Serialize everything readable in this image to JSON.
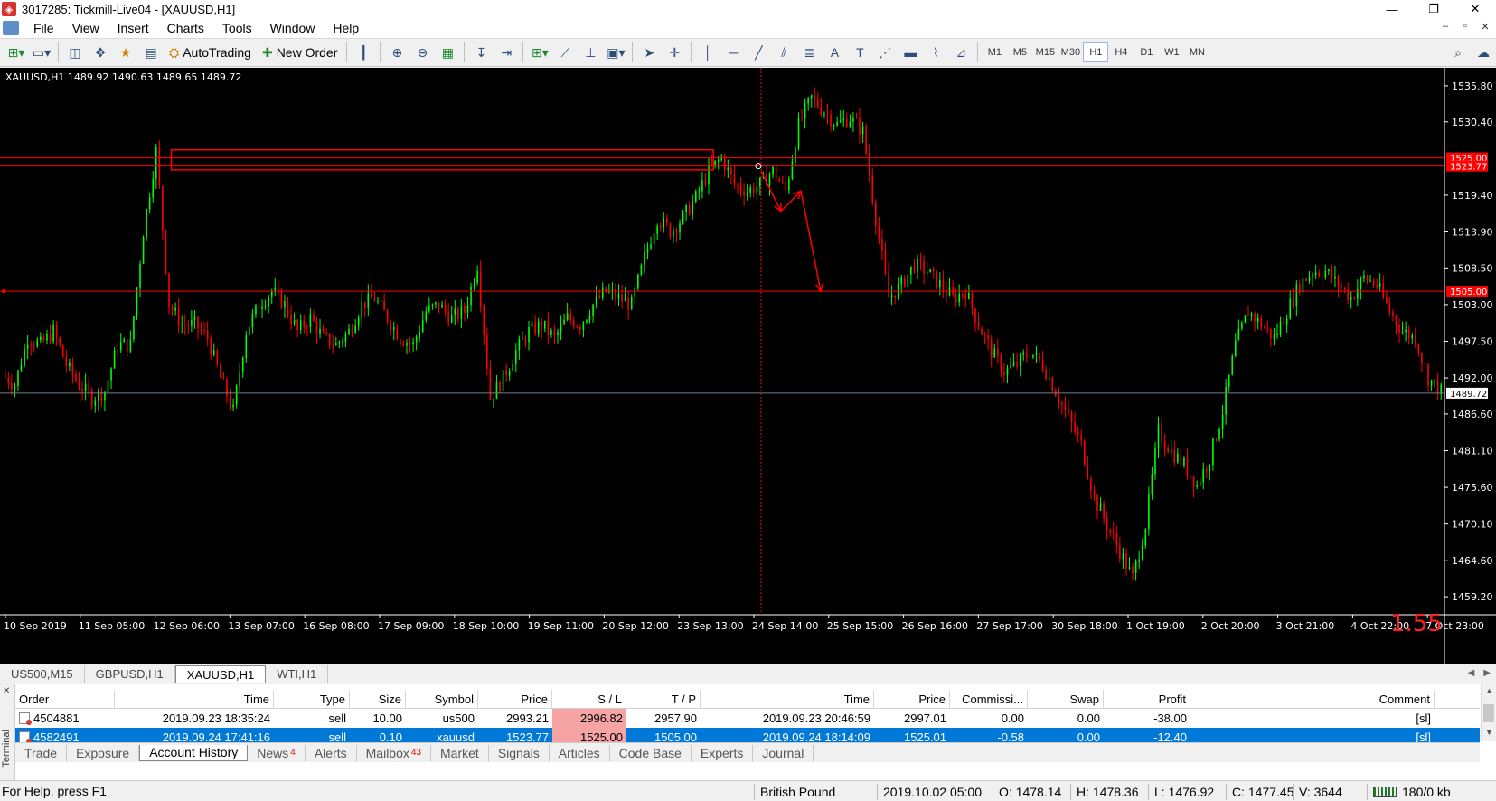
{
  "window": {
    "title": "3017285: Tickmill-Live04 - [XAUUSD,H1]",
    "controls": [
      "—",
      "❐",
      "✕"
    ],
    "mdi_controls": [
      "–",
      "▫",
      "✕"
    ]
  },
  "menu": [
    "File",
    "View",
    "Insert",
    "Charts",
    "Tools",
    "Window",
    "Help"
  ],
  "toolbar": {
    "autotrading_label": "AutoTrading",
    "new_order_label": "New Order",
    "timeframes": [
      "M1",
      "M5",
      "M15",
      "M30",
      "H1",
      "H4",
      "D1",
      "W1",
      "MN"
    ],
    "active_timeframe": "H1"
  },
  "chart": {
    "header": "XAUUSD,H1  1489.92 1490.63 1489.65 1489.72",
    "spread": "1.55",
    "price_labels": [
      "1535.80",
      "1530.40",
      "1519.40",
      "1513.90",
      "1508.50",
      "1503.00",
      "1497.50",
      "1492.00",
      "1486.60",
      "1481.10",
      "1475.60",
      "1470.10",
      "1464.60",
      "1459.20"
    ],
    "marker_labels": [
      "1525.00",
      "1523.77",
      "1505.00",
      "1489.72"
    ],
    "time_labels": [
      "10 Sep 2019",
      "11 Sep 05:00",
      "12 Sep 06:00",
      "13 Sep 07:00",
      "16 Sep 08:00",
      "17 Sep 09:00",
      "18 Sep 10:00",
      "19 Sep 11:00",
      "20 Sep 12:00",
      "23 Sep 13:00",
      "24 Sep 14:00",
      "25 Sep 15:00",
      "26 Sep 16:00",
      "27 Sep 17:00",
      "30 Sep 18:00",
      "1 Oct 19:00",
      "2 Oct 20:00",
      "3 Oct 21:00",
      "4 Oct 22:00",
      "7 Oct 23:00"
    ],
    "colors": {
      "bull": "#00ff00",
      "bear": "#ff0000",
      "background": "#000000",
      "line_red": "#ff0000",
      "bid_line": "#708090"
    }
  },
  "chart_data": {
    "type": "candlestick",
    "symbol": "XAUUSD",
    "timeframe": "H1",
    "ylim": [
      1456.5,
      1538.5
    ],
    "x": [
      "10 Sep 2019",
      "11 Sep 05:00",
      "12 Sep 06:00",
      "13 Sep 07:00",
      "16 Sep 08:00",
      "17 Sep 09:00",
      "18 Sep 10:00",
      "19 Sep 11:00",
      "20 Sep 12:00",
      "23 Sep 13:00",
      "24 Sep 14:00",
      "25 Sep 15:00",
      "26 Sep 16:00",
      "27 Sep 17:00",
      "30 Sep 18:00",
      "1 Oct 19:00",
      "2 Oct 20:00",
      "3 Oct 21:00",
      "4 Oct 22:00",
      "7 Oct 23:00"
    ],
    "close_path": [
      1492.5,
      1491.0,
      1498.0,
      1497.0,
      1499.0,
      1494.0,
      1491.0,
      1489.0,
      1490.0,
      1497.0,
      1497.0,
      1514.0,
      1526.0,
      1503.0,
      1500.0,
      1500.0,
      1498.0,
      1492.0,
      1487.0,
      1499.0,
      1503.0,
      1505.0,
      1503.0,
      1499.0,
      1501.0,
      1498.0,
      1497.0,
      1499.0,
      1503.0,
      1504.0,
      1501.0,
      1498.0,
      1497.0,
      1502.0,
      1503.0,
      1501.0,
      1502.0,
      1509.0,
      1489.0,
      1492.0,
      1496.0,
      1499.0,
      1500.0,
      1498.0,
      1501.0,
      1500.0,
      1503.0,
      1505.0,
      1504.0,
      1503.0,
      1510.0,
      1516.0,
      1514.0,
      1516.0,
      1519.0,
      1523.0,
      1525.0,
      1521.0,
      1520.0,
      1521.0,
      1523.0,
      1520.0,
      1530.0,
      1534.0,
      1532.0,
      1530.0,
      1531.0,
      1529.0,
      1516.0,
      1504.0,
      1506.0,
      1509.0,
      1508.0,
      1506.0,
      1504.0,
      1505.0,
      1500.0,
      1496.0,
      1493.0,
      1494.0,
      1496.0,
      1494.0,
      1490.0,
      1486.0,
      1482.0,
      1474.0,
      1470.0,
      1466.0,
      1462.0,
      1470.0,
      1484.0,
      1481.0,
      1479.0,
      1476.0,
      1480.0,
      1487.0,
      1497.0,
      1502.0,
      1500.0,
      1498.0,
      1502.0,
      1506.0,
      1508.0,
      1508.0,
      1506.0,
      1504.0,
      1507.0,
      1506.0,
      1502.0,
      1499.0,
      1498.0,
      1492.0,
      1490.0
    ],
    "last_price": 1489.72,
    "horizontal_lines": [
      1525.0,
      1523.77,
      1505.0
    ],
    "bid_line": 1489.72,
    "zone": {
      "from": "12 Sep 06:00",
      "to": "23 Sep 13:00",
      "price_low": 1523.2,
      "price_high": 1526.2
    },
    "vertical_marker": "24 Sep 14:00",
    "arrows": [
      {
        "from": [
          1523.0,
          0
        ],
        "to": [
          1517.0,
          1
        ]
      },
      {
        "from": [
          1517.0,
          1
        ],
        "to": [
          1520.0,
          2
        ]
      },
      {
        "from": [
          1520.0,
          2
        ],
        "to": [
          1505.0,
          3
        ]
      }
    ],
    "grid": false
  },
  "chart_tabs": [
    "US500,M15",
    "GBPUSD,H1",
    "XAUUSD,H1",
    "WTI,H1"
  ],
  "active_chart_tab": "XAUUSD,H1",
  "terminal": {
    "side_label": "Terminal",
    "columns": [
      "Order",
      "Time",
      "Type",
      "Size",
      "Symbol",
      "Price",
      "S / L",
      "T / P",
      "Time",
      "Price",
      "Commissi...",
      "Swap",
      "Profit",
      "Comment"
    ],
    "rows": [
      [
        "4504881",
        "2019.09.23 18:35:24",
        "sell",
        "10.00",
        "us500",
        "2993.21",
        "2996.82",
        "2957.90",
        "2019.09.23 20:46:59",
        "2997.01",
        "0.00",
        "0.00",
        "-38.00",
        "[sl]"
      ],
      [
        "4582491",
        "2019.09.24 17:41:16",
        "sell",
        "0.10",
        "xauusd",
        "1523.77",
        "1525.00",
        "1505.00",
        "2019.09.24 18:14:09",
        "1525.01",
        "-0.58",
        "0.00",
        "-12.40",
        "[sl]"
      ]
    ],
    "selected_row": 1,
    "tabs": [
      {
        "label": "Trade",
        "badge": ""
      },
      {
        "label": "Exposure",
        "badge": ""
      },
      {
        "label": "Account History",
        "badge": ""
      },
      {
        "label": "News",
        "badge": "4"
      },
      {
        "label": "Alerts",
        "badge": ""
      },
      {
        "label": "Mailbox",
        "badge": "43"
      },
      {
        "label": "Market",
        "badge": ""
      },
      {
        "label": "Signals",
        "badge": ""
      },
      {
        "label": "Articles",
        "badge": ""
      },
      {
        "label": "Code Base",
        "badge": ""
      },
      {
        "label": "Experts",
        "badge": ""
      },
      {
        "label": "Journal",
        "badge": ""
      }
    ],
    "active_tab": "Account History"
  },
  "status": {
    "help": "For Help, press F1",
    "profile": "British Pound",
    "datetime": "2019.10.02 05:00",
    "open": "O: 1478.14",
    "high": "H: 1478.36",
    "low": "L: 1476.92",
    "close": "C: 1477.45",
    "volume": "V: 3644",
    "traffic": "180/0 kb"
  }
}
